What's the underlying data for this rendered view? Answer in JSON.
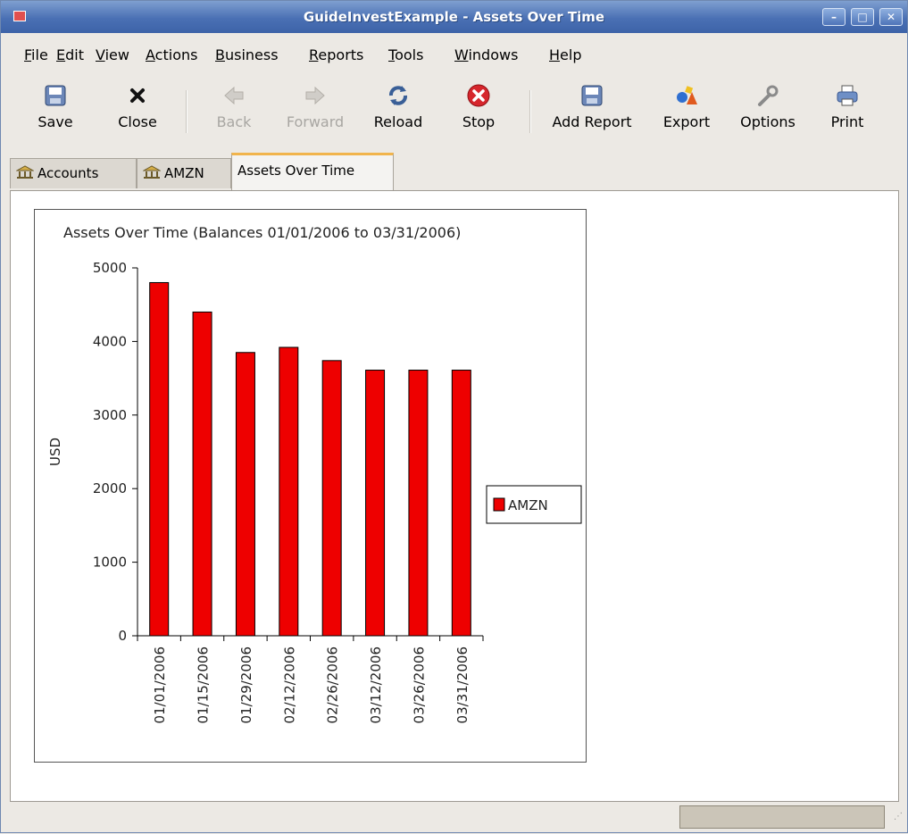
{
  "window": {
    "title": "GuideInvestExample - Assets Over Time"
  },
  "menu": {
    "items": [
      "File",
      "Edit",
      "View",
      "Actions",
      "Business",
      "Reports",
      "Tools",
      "Windows",
      "Help"
    ]
  },
  "toolbar": {
    "save": "Save",
    "close": "Close",
    "back": "Back",
    "forward": "Forward",
    "reload": "Reload",
    "stop": "Stop",
    "add_report": "Add Report",
    "export": "Export",
    "options": "Options",
    "print": "Print"
  },
  "tabs": [
    {
      "label": "Accounts",
      "active": false
    },
    {
      "label": "AMZN",
      "active": false
    },
    {
      "label": "Assets Over Time",
      "active": true
    }
  ],
  "chart_data": {
    "type": "bar",
    "title": "Assets Over Time (Balances 01/01/2006 to 03/31/2006)",
    "xlabel": "",
    "ylabel": "USD",
    "ylim": [
      0,
      5000
    ],
    "yticks": [
      0,
      1000,
      2000,
      3000,
      4000,
      5000
    ],
    "categories": [
      "01/01/2006",
      "01/15/2006",
      "01/29/2006",
      "02/12/2006",
      "02/26/2006",
      "03/12/2006",
      "03/26/2006",
      "03/31/2006"
    ],
    "series": [
      {
        "name": "AMZN",
        "color": "#ee0000",
        "values": [
          4800,
          4400,
          3850,
          3920,
          3740,
          3610,
          3610,
          3610
        ]
      }
    ],
    "legend": "right",
    "grid": false
  }
}
